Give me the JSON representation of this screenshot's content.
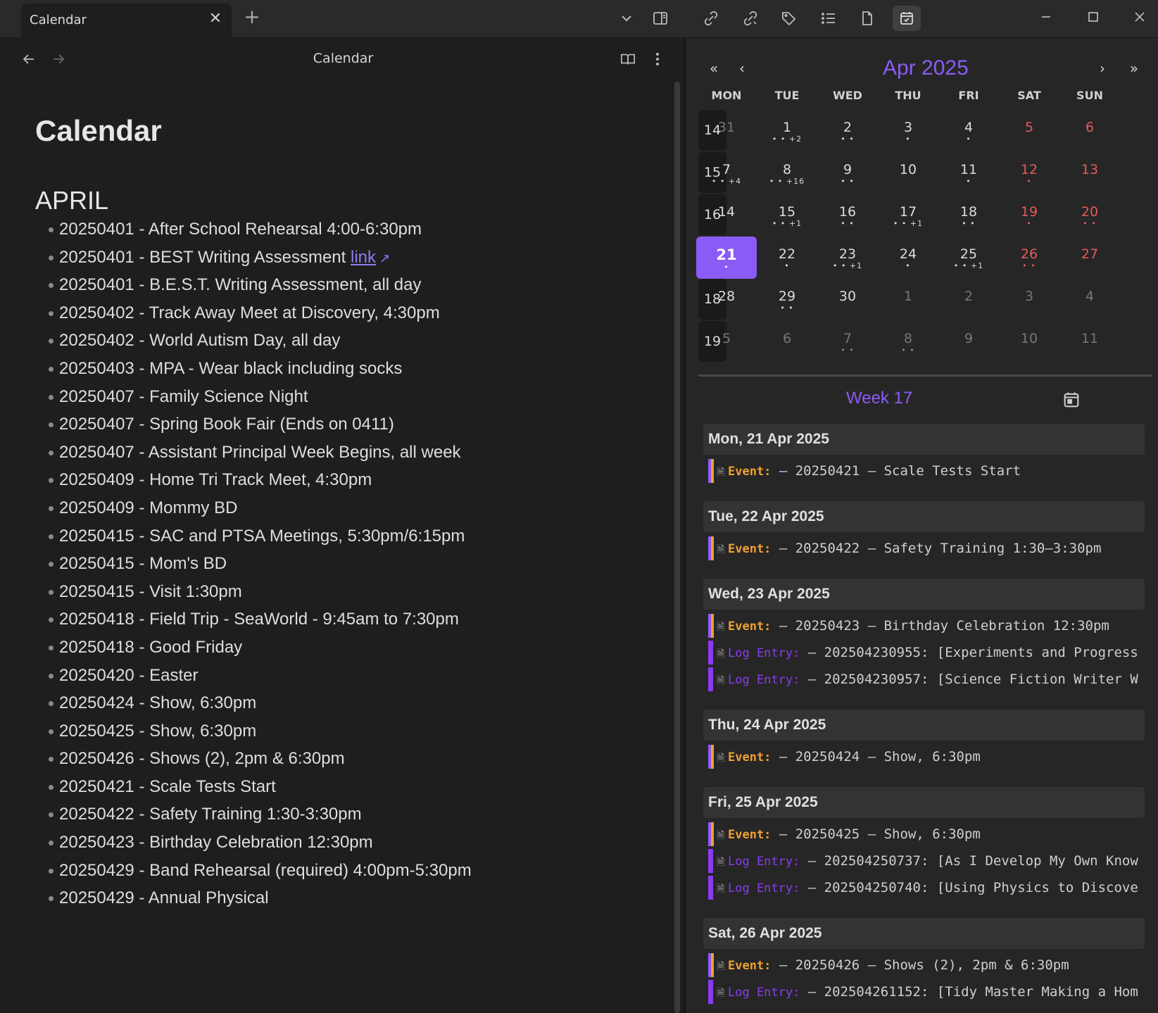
{
  "tab": {
    "title": "Calendar",
    "close": "✕",
    "new": "+"
  },
  "left": {
    "header_title": "Calendar",
    "page_title": "Calendar",
    "section": "APRIL",
    "events": [
      "20250401 - After School Rehearsal 4:00-6:30pm",
      "20250401 - BEST Writing Assessment ",
      "20250401 - B.E.S.T. Writing Assessment, all day",
      "20250402 - Track Away Meet at Discovery, 4:30pm",
      "20250402 - World Autism Day, all day",
      "20250403 - MPA - Wear black including socks",
      "20250407 - Family Science Night",
      "20250407 - Spring Book Fair (Ends on 0411)",
      "20250407 - Assistant Principal Week Begins, all week",
      "20250409 - Home Tri Track Meet, 4:30pm",
      "20250409 - Mommy BD",
      "20250415 - SAC and PTSA Meetings, 5:30pm/6:15pm",
      "20250415 - Mom's BD",
      "20250415 - Visit 1:30pm",
      "20250418 - Field Trip - SeaWorld - 9:45am to 7:30pm",
      "20250418 - Good Friday",
      "20250420 - Easter",
      "20250424 - Show, 6:30pm",
      "20250425 - Show, 6:30pm",
      "20250426 - Shows (2), 2pm & 6:30pm",
      "20250421 - Scale Tests Start",
      "20250422 - Safety Training 1:30-3:30pm",
      "20250423 - Birthday Celebration 12:30pm",
      "20250429 - Band Rehearsal (required) 4:00pm-5:30pm",
      "20250429 - Annual Physical"
    ],
    "link_text": "link"
  },
  "calendar": {
    "month_title": "Apr 2025",
    "nav": {
      "prev_year": "«",
      "prev_month": "‹",
      "next_month": "›",
      "next_year": "»"
    },
    "dows": [
      "MON",
      "TUE",
      "WED",
      "THU",
      "FRI",
      "SAT",
      "SUN"
    ],
    "weeks": [
      {
        "week": "14",
        "days": [
          {
            "n": "31",
            "dots": "",
            "other": true
          },
          {
            "n": "1",
            "dots": "• • +2"
          },
          {
            "n": "2",
            "dots": "• •"
          },
          {
            "n": "3",
            "dots": "•"
          },
          {
            "n": "4",
            "dots": "•"
          },
          {
            "n": "5",
            "dots": ""
          },
          {
            "n": "6",
            "dots": ""
          }
        ]
      },
      {
        "week": "15",
        "days": [
          {
            "n": "7",
            "dots": "• • +4"
          },
          {
            "n": "8",
            "dots": "• • +16"
          },
          {
            "n": "9",
            "dots": "• •"
          },
          {
            "n": "10",
            "dots": ""
          },
          {
            "n": "11",
            "dots": "•"
          },
          {
            "n": "12",
            "dots": "•"
          },
          {
            "n": "13",
            "dots": ""
          }
        ]
      },
      {
        "week": "16",
        "days": [
          {
            "n": "14",
            "dots": ""
          },
          {
            "n": "15",
            "dots": "• • +1"
          },
          {
            "n": "16",
            "dots": "• •"
          },
          {
            "n": "17",
            "dots": "• • +1"
          },
          {
            "n": "18",
            "dots": "• •"
          },
          {
            "n": "19",
            "dots": "•"
          },
          {
            "n": "20",
            "dots": "• •"
          }
        ]
      },
      {
        "week": "17",
        "days": [
          {
            "n": "21",
            "dots": "•",
            "today": true
          },
          {
            "n": "22",
            "dots": "•"
          },
          {
            "n": "23",
            "dots": "• • +1"
          },
          {
            "n": "24",
            "dots": "•"
          },
          {
            "n": "25",
            "dots": "• • +1"
          },
          {
            "n": "26",
            "dots": "• •"
          },
          {
            "n": "27",
            "dots": ""
          }
        ]
      },
      {
        "week": "18",
        "days": [
          {
            "n": "28",
            "dots": ""
          },
          {
            "n": "29",
            "dots": "• •"
          },
          {
            "n": "30",
            "dots": ""
          },
          {
            "n": "1",
            "dots": "",
            "other": true
          },
          {
            "n": "2",
            "dots": "",
            "other": true
          },
          {
            "n": "3",
            "dots": "",
            "other": true
          },
          {
            "n": "4",
            "dots": "",
            "other": true
          }
        ]
      },
      {
        "week": "19",
        "days": [
          {
            "n": "5",
            "dots": "",
            "other": true
          },
          {
            "n": "6",
            "dots": "",
            "other": true
          },
          {
            "n": "7",
            "dots": "• •",
            "other": true
          },
          {
            "n": "8",
            "dots": "• •",
            "other": true
          },
          {
            "n": "9",
            "dots": "",
            "other": true
          },
          {
            "n": "10",
            "dots": "",
            "other": true
          },
          {
            "n": "11",
            "dots": "",
            "other": true
          }
        ]
      }
    ]
  },
  "week_view": {
    "title": "Week 17",
    "days": [
      {
        "head": "Mon, 21 Apr 2025",
        "entries": [
          {
            "kind": "event",
            "label": "Event:",
            "text": " – 20250421 – Scale Tests Start"
          }
        ]
      },
      {
        "head": "Tue, 22 Apr 2025",
        "entries": [
          {
            "kind": "event",
            "label": "Event:",
            "text": " – 20250422 – Safety Training 1:30–3:30pm"
          }
        ]
      },
      {
        "head": "Wed, 23 Apr 2025",
        "entries": [
          {
            "kind": "event",
            "label": "Event:",
            "text": " – 20250423 – Birthday Celebration 12:30pm"
          },
          {
            "kind": "log",
            "label": "Log Entry:",
            "text": " – 202504230955: [Experiments and Progress"
          },
          {
            "kind": "log",
            "label": "Log Entry:",
            "text": " – 202504230957: [Science Fiction Writer W"
          }
        ]
      },
      {
        "head": "Thu, 24 Apr 2025",
        "entries": [
          {
            "kind": "event",
            "label": "Event:",
            "text": " – 20250424 – Show, 6:30pm"
          }
        ]
      },
      {
        "head": "Fri, 25 Apr 2025",
        "entries": [
          {
            "kind": "event",
            "label": "Event:",
            "text": " – 20250425 – Show, 6:30pm"
          },
          {
            "kind": "log",
            "label": "Log Entry:",
            "text": " – 202504250737: [As I Develop My Own Know"
          },
          {
            "kind": "log",
            "label": "Log Entry:",
            "text": " – 202504250740: [Using Physics to Discove"
          }
        ]
      },
      {
        "head": "Sat, 26 Apr 2025",
        "entries": [
          {
            "kind": "event",
            "label": "Event:",
            "text": " – 20250426 – Shows (2), 2pm & 6:30pm"
          },
          {
            "kind": "log",
            "label": "Log Entry:",
            "text": " – 202504261152: [Tidy Master Making a Hom"
          }
        ]
      }
    ]
  },
  "colors": {
    "accent": "#8a5cf5",
    "weekend": "#e65a5a",
    "event_label": "#f0a030",
    "log_label": "#8a3cf0"
  }
}
